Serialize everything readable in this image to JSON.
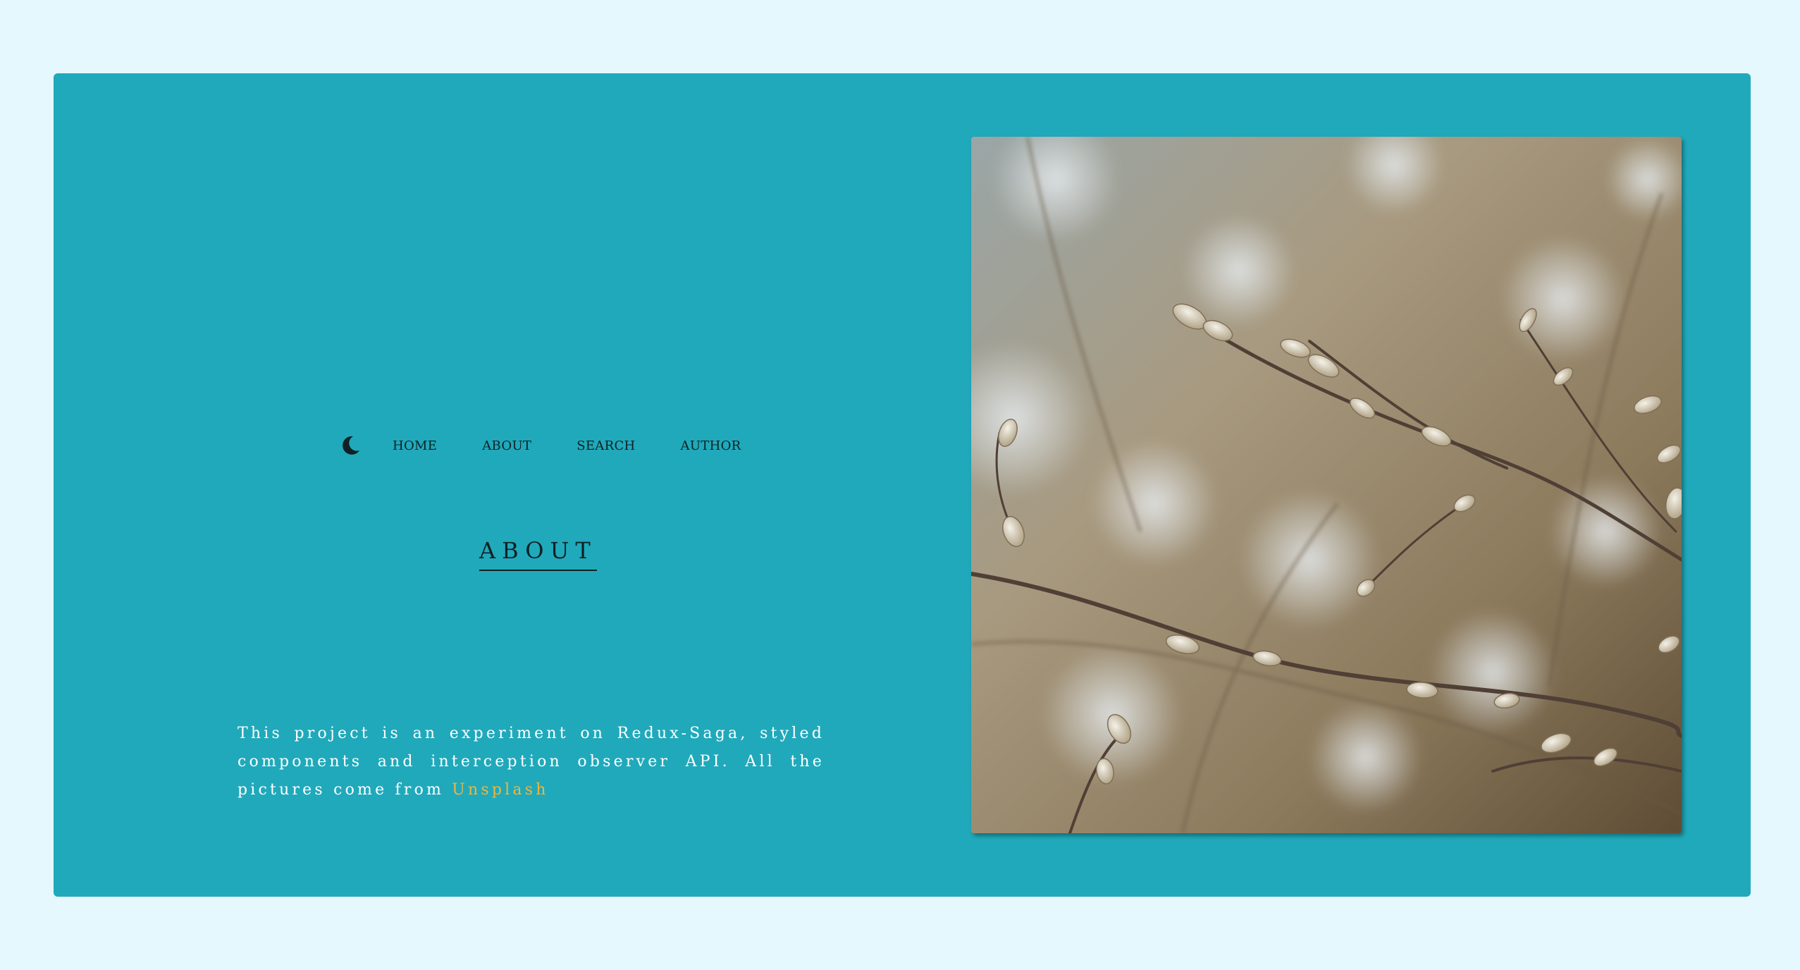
{
  "nav": {
    "theme_icon": "moon-icon",
    "items": [
      {
        "label": "HOME"
      },
      {
        "label": "ABOUT"
      },
      {
        "label": "SEARCH"
      },
      {
        "label": "AUTHOR"
      }
    ]
  },
  "about": {
    "title": "ABOUT",
    "text": "This project is an experiment on Redux-Saga, styled components and interception observer API. All the pictures come from",
    "link_label": "Unsplash"
  },
  "colors": {
    "page_background": "#e4f8fd",
    "card_background": "#20a9bb",
    "link_accent": "#f0b63a",
    "text_dark": "#0f2124"
  }
}
